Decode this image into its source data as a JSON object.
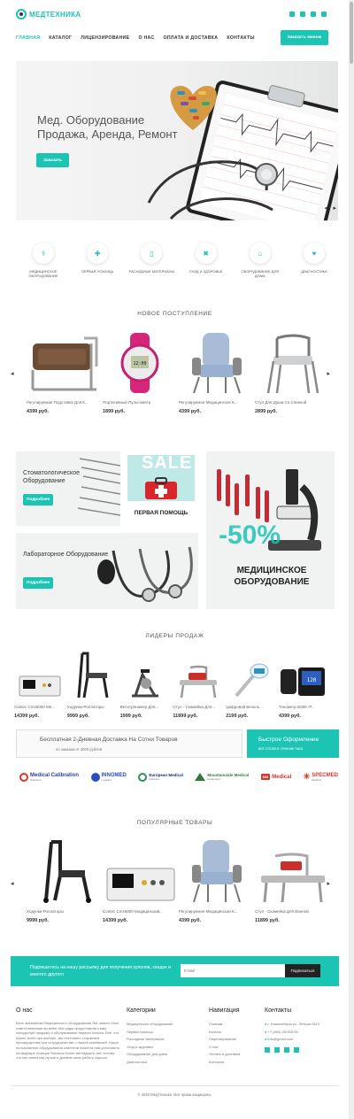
{
  "brand": {
    "name": "МЕДТЕХНИКА"
  },
  "nav": {
    "items": [
      "ГЛАВНАЯ",
      "КАТАЛОГ",
      "ЛИЦЕНЗИРОВАНИЕ",
      "О НАС",
      "ОПЛАТА И ДОСТАВКА",
      "КОНТАКТЫ"
    ],
    "call_button": "Заказать звонок"
  },
  "social": [
    "vk-icon",
    "facebook-icon",
    "twitter-icon",
    "youtube-icon"
  ],
  "hero": {
    "title": "Мед. Оборудование Продажа, Аренда, Ремонт",
    "button": "Заказать",
    "prev": "◂",
    "next": "▸"
  },
  "categories": [
    {
      "label": "МЕДИЦИНСКОЕ ОБОРУДОВАНИЕ",
      "icon": "doctor-icon"
    },
    {
      "label": "ПЕРВАЯ ПОМОЩЬ",
      "icon": "first-aid-icon"
    },
    {
      "label": "РАСХОДНЫЕ МАТЕРИАЛЫ",
      "icon": "pill-bottle-icon"
    },
    {
      "label": "УХОД И ЗДОРОВЬЕ",
      "icon": "bandage-icon"
    },
    {
      "label": "ОБОРУДОВАНИЕ ДЛЯ ДОМА",
      "icon": "house-icon"
    },
    {
      "label": "ДИАГНОСТИКА",
      "icon": "heart-pulse-icon"
    }
  ],
  "new_arrivals": {
    "title": "НОВОЕ ПОСТУПЛЕНИЕ",
    "products": [
      {
        "name": "Регулируемая Подставка Для К...",
        "price": "4399 руб."
      },
      {
        "name": "Портативный Пульсометр",
        "price": "1899 руб."
      },
      {
        "name": "Регулируемое Медицинское К...",
        "price": "4399 руб."
      },
      {
        "name": "Стул Для Душа Со Спинкой",
        "price": "2899 руб."
      }
    ]
  },
  "banners": {
    "dental": {
      "title": "Стоматологическое Оборудование",
      "button": "Подробнее"
    },
    "first_aid": {
      "sale": "SALE",
      "title": "ПЕРВАЯ ПОМОЩЬ"
    },
    "lab": {
      "title": "Лабораторное Оборудование",
      "button": "Подробнее"
    },
    "medical": {
      "discount": "-50%",
      "title": "МЕДИЦИНСКОЕ ОБОРУДОВАНИЕ"
    }
  },
  "bestsellers": {
    "title": "ЛИДЕРЫ ПРОДАЖ",
    "products": [
      {
        "name": "Contec Cms6000 Ме...",
        "price": "14399 руб."
      },
      {
        "name": "Ходунки-Роллаторы",
        "price": "9999 руб."
      },
      {
        "name": "Велотренажер Для...",
        "price": "1999 руб."
      },
      {
        "name": "Стул - Скамейка Для...",
        "price": "11899 руб."
      },
      {
        "name": "Цифровой Безоль...",
        "price": "2199 руб."
      },
      {
        "name": "Тонометр B360 -Р...",
        "price": "4399 руб."
      }
    ]
  },
  "delivery": {
    "title": "Бесплатная 2-Дневная Доставка На Сотни Товаров",
    "subtitle": "по заказам от 3000 рублей"
  },
  "fast_order": {
    "title": "Быстрое Оформление",
    "subtitle": "всё готово в течение часа"
  },
  "partners": [
    {
      "name": "Medical Calibration",
      "sub": "Solutions",
      "color": "#2b3fa5"
    },
    {
      "name": "INNOMED",
      "sub": "Logistics",
      "color": "#2b4fbf"
    },
    {
      "name": "European Medical",
      "sub": "Solutions",
      "color": "#1a2a6a"
    },
    {
      "name": "Mountainside Medical",
      "sub": "Equipment",
      "color": "#2e7a3c"
    },
    {
      "name": "Medical",
      "sub": "",
      "color": "#d9352a"
    },
    {
      "name": "SPECMED",
      "sub": "Medical",
      "color": "#d9352a"
    }
  ],
  "popular": {
    "title": "ПОПУЛЯРНЫЕ ТОВАРЫ",
    "products": [
      {
        "name": "Ходунки-Роллаторы",
        "price": "9999 руб."
      },
      {
        "name": "Contec Cms6000 Медицинский...",
        "price": "14399 руб."
      },
      {
        "name": "Регулируемое Медицинское К...",
        "price": "4399 руб."
      },
      {
        "name": "Стул - Скамейка Для Ванной",
        "price": "11899 руб."
      }
    ]
  },
  "newsletter": {
    "text": "Подпишитесь на нашу рассылку для получения купонов, скидок и многого другого",
    "placeholder": "E-Mail",
    "button": "Подписаться"
  },
  "footer": {
    "about": {
      "title": "О нас",
      "text": "Быть магазином Медицинского оборудования №1 значит быть ответственными во всём. Мы рады предоставлять вам конкурсную продажу и обслуживание первого класса. Всё, что нужно знать при выборе, мы постоянно стараемся преимущества при сотрудничестве с нашей компанией. Наши пользователи оборудования клиентов помогли нам установить на ведущие позиции бизнеса более пятнадцати лет, потому что мы знаем как лучше и делаем свою работу хорошо."
    },
    "categories": {
      "title": "Категории",
      "items": [
        "Медицинское оборудование",
        "Первая помощь",
        "Расходные материалы",
        "Уход и здоровье",
        "Оборудование для дома",
        "Диагностика"
      ]
    },
    "navigation": {
      "title": "Навигация",
      "items": [
        "Главная",
        "Каталог",
        "Лицензирование",
        "О нас",
        "Оплата и доставка",
        "Контакты"
      ]
    },
    "contacts": {
      "title": "Контакты",
      "items": [
        "г. Новосибирск ул. Ленина №10",
        "+7 (800) 00-000-00",
        "info@gmail.com"
      ]
    }
  },
  "copyright": "© 2020 МедТехника. Все права защищены."
}
